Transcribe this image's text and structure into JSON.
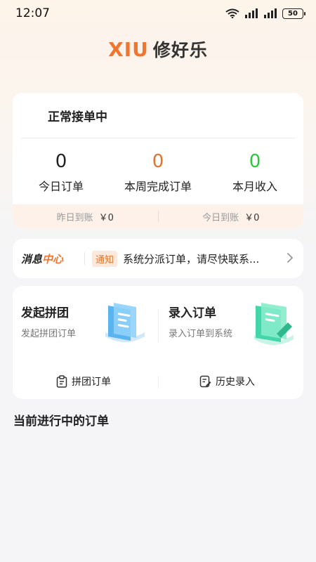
{
  "status_bar": {
    "time": "12:07",
    "battery": "50"
  },
  "header": {
    "logo_latin": "XIU",
    "logo_cn": "修好乐"
  },
  "stats": {
    "status_title": "正常接单中",
    "items": [
      {
        "value": "0",
        "label": "今日订单",
        "color": "#222222"
      },
      {
        "value": "0",
        "label": "本周完成订单",
        "color": "#e2752d"
      },
      {
        "value": "0",
        "label": "本月收入",
        "color": "#2cc93d"
      }
    ],
    "settlement": [
      {
        "label": "昨日到账",
        "amount": "￥0"
      },
      {
        "label": "今日到账",
        "amount": "￥0"
      }
    ]
  },
  "message": {
    "logo_part1": "消息",
    "logo_part2": "中心",
    "tag": "通知",
    "text": "系统分派订单，请尽快联系..."
  },
  "actions": {
    "items": [
      {
        "title": "发起拼团",
        "subtitle": "发起拼团订单"
      },
      {
        "title": "录入订单",
        "subtitle": "录入订单到系统"
      }
    ],
    "quick_links": [
      {
        "label": "拼团订单",
        "icon": "clipboard-icon"
      },
      {
        "label": "历史录入",
        "icon": "history-edit-icon"
      }
    ]
  },
  "orders": {
    "section_title": "当前进行中的订单"
  },
  "colors": {
    "accent": "#f07630",
    "green": "#2cc93d",
    "teal": "#43d6a8",
    "blue": "#5ab4f0"
  }
}
